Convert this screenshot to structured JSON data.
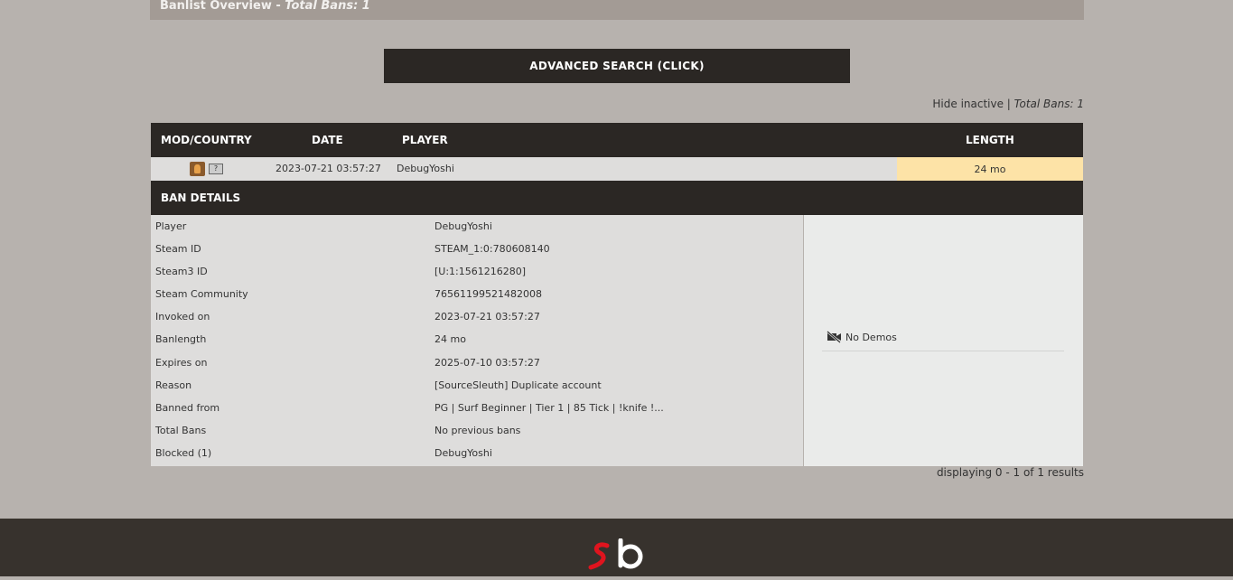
{
  "header": {
    "title": "Banlist Overview - ",
    "title_italic": "Total Bans: 1"
  },
  "advanced_search": {
    "label": "ADVANCED SEARCH (CLICK)"
  },
  "filter": {
    "hide_inactive": "Hide inactive",
    "separator": " | ",
    "total": "Total Bans: 1"
  },
  "table": {
    "headers": {
      "mod_country": "MOD/COUNTRY",
      "date": "DATE",
      "player": "PLAYER",
      "length": "LENGTH"
    },
    "row": {
      "flag_text": "?",
      "date": "2023-07-21 03:57:27",
      "player": "DebugYoshi",
      "length": "24 mo",
      "length_color": "#fde3a7"
    }
  },
  "details": {
    "title": "BAN DETAILS",
    "rows": [
      {
        "key": "Player",
        "value": "DebugYoshi"
      },
      {
        "key": "Steam ID",
        "value": "STEAM_1:0:780608140"
      },
      {
        "key": "Steam3 ID",
        "value": "[U:1:1561216280]"
      },
      {
        "key": "Steam Community",
        "value": "76561199521482008"
      },
      {
        "key": "Invoked on",
        "value": "2023-07-21 03:57:27"
      },
      {
        "key": "Banlength",
        "value": "24 mo"
      },
      {
        "key": "Expires on",
        "value": "2025-07-10 03:57:27"
      },
      {
        "key": "Reason",
        "value": "[SourceSleuth] Duplicate account"
      },
      {
        "key": "Banned from",
        "value": "PG | Surf Beginner | Tier 1 | 85 Tick | !knife !..."
      },
      {
        "key": "Total Bans",
        "value": "No previous bans"
      },
      {
        "key": "Blocked (1)",
        "value": "DebugYoshi"
      }
    ],
    "demos": {
      "icon": "no-video-icon",
      "label": "No Demos"
    }
  },
  "results": {
    "text": "displaying 0 - 1 of 1 results"
  },
  "footer": {
    "logo_icon": "sourcebans-logo-icon"
  },
  "colors": {
    "background": "#b7b2ae",
    "header_dark": "#2b2724",
    "footer": "#37322d",
    "logo_red": "#e0141e"
  }
}
